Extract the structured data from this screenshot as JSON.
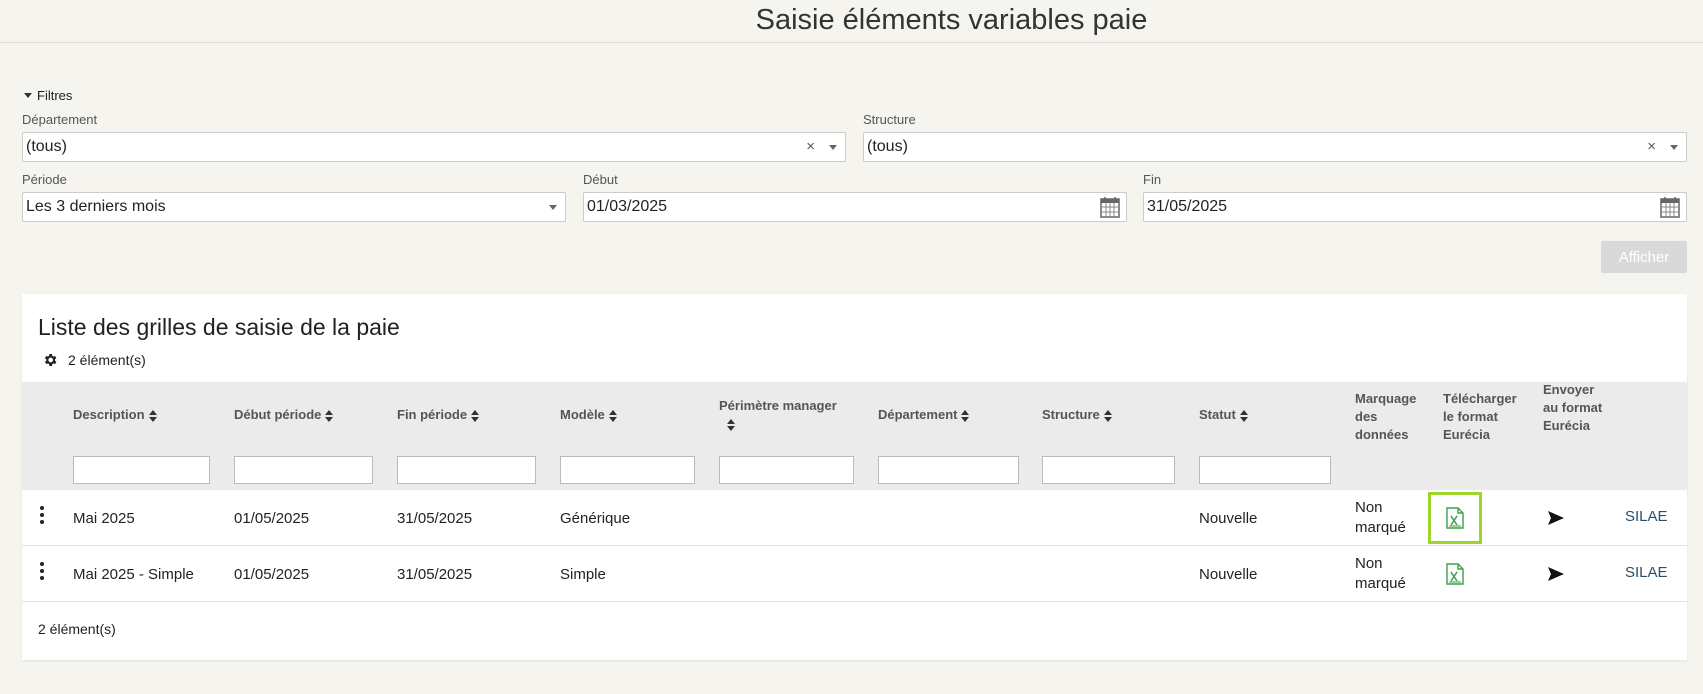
{
  "header": {
    "title": "Saisie éléments variables paie"
  },
  "filters": {
    "toggle_label": "Filtres",
    "departement": {
      "label": "Département",
      "value": "(tous)"
    },
    "structure": {
      "label": "Structure",
      "value": "(tous)"
    },
    "periode": {
      "label": "Période",
      "value": "Les 3 derniers mois"
    },
    "debut": {
      "label": "Début",
      "value": "01/03/2025"
    },
    "fin": {
      "label": "Fin",
      "value": "31/05/2025"
    },
    "clear_glyph": "×",
    "afficher_label": "Afficher"
  },
  "list": {
    "title": "Liste des grilles de saisie de la paie",
    "count_text": "2 élément(s)",
    "footer_count": "2 élément(s)",
    "columns": {
      "description": "Description",
      "debut_periode": "Début période",
      "fin_periode": "Fin période",
      "modele": "Modèle",
      "perimetre": "Périmètre manager",
      "departement": "Département",
      "structure": "Structure",
      "statut": "Statut",
      "marquage": "Marquage des données",
      "telecharger": "Télécharger le format Eurécia",
      "envoyer": "Envoyer au format Eurécia"
    },
    "rows": [
      {
        "description": "Mai 2025",
        "debut": "01/05/2025",
        "fin": "31/05/2025",
        "modele": "Générique",
        "statut": "Nouvelle",
        "marquage": "Non marqué",
        "action": "SILAE"
      },
      {
        "description": "Mai 2025 - Simple",
        "debut": "01/05/2025",
        "fin": "31/05/2025",
        "modele": "Simple",
        "statut": "Nouvelle",
        "marquage": "Non marqué",
        "action": "SILAE"
      }
    ]
  },
  "colors": {
    "highlight": "#9fd62c",
    "excel_green": "#3aa14a",
    "link": "#2a4f6b"
  },
  "icons": [
    "gear-icon",
    "calendar-icon",
    "excel-icon",
    "send-icon",
    "kebab-menu-icon",
    "sort-icon",
    "caret-down-icon",
    "clear-icon"
  ]
}
